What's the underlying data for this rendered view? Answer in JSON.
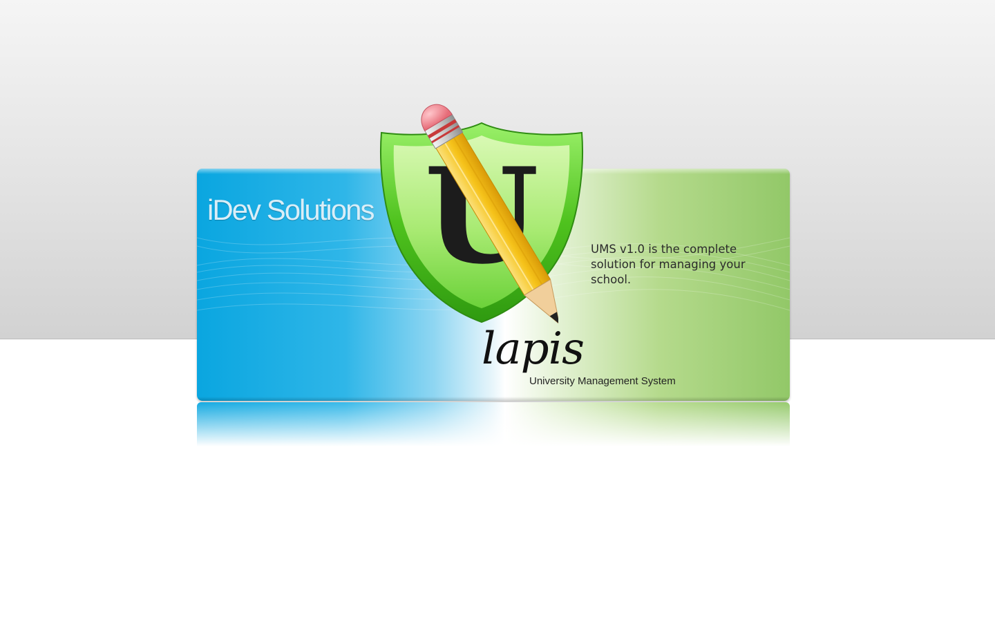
{
  "splash": {
    "company_name": "iDev Solutions",
    "logo_letter": "U",
    "description": "UMS v1.0 is the complete solution for managing your school.",
    "product_name": "lapis",
    "product_tagline": "University Management System"
  },
  "colors": {
    "blue": "#0aa6e0",
    "green": "#92c868",
    "shield_green": "#6fd23a",
    "pencil_yellow": "#f6c31a",
    "eraser_pink": "#f08a92"
  },
  "icons": {
    "shield": "shield-icon",
    "pencil": "pencil-icon"
  }
}
